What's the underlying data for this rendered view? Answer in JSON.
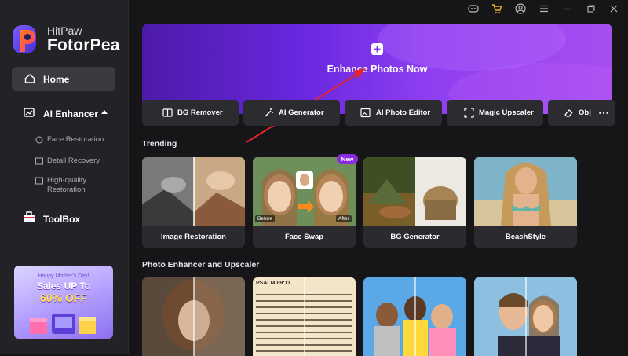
{
  "brand": {
    "line1": "HitPaw",
    "line2": "FotorPea"
  },
  "sidebar": {
    "home": "Home",
    "ai_enhancer": "AI Enhancer",
    "sub_items": [
      {
        "label": "Face Restoration",
        "icon": "face-icon"
      },
      {
        "label": "Detail Recovery",
        "icon": "image-icon"
      },
      {
        "label": "High-quality",
        "label2": "Restoration",
        "icon": "hq-icon"
      }
    ],
    "toolbox": "ToolBox",
    "promo": {
      "line1": "Happy Mother's Day!",
      "line2": "Sales UP To",
      "line3": "60% OFF"
    }
  },
  "hero": {
    "label": "Enhance Photos Now"
  },
  "tools": [
    {
      "label": "BG Remover",
      "icon": "bg-remover-icon"
    },
    {
      "label": "AI Generator",
      "icon": "magic-wand-icon"
    },
    {
      "label": "AI Photo Editor",
      "icon": "photo-edit-icon"
    },
    {
      "label": "Magic Upscaler",
      "icon": "upscale-icon"
    },
    {
      "label": "Obj",
      "icon": "eraser-icon"
    }
  ],
  "trending": {
    "title": "Trending",
    "cards": [
      {
        "label": "Image Restoration"
      },
      {
        "label": "Face Swap",
        "badge": "New",
        "before": "Before",
        "after": "After"
      },
      {
        "label": "BG Generator"
      },
      {
        "label": "BeachStyle"
      }
    ]
  },
  "enhancer": {
    "title": "Photo Enhancer and Upscaler",
    "psalm": "PSALM 89:11"
  },
  "colors": {
    "accent": "#7c3aed",
    "sidebar": "#232327",
    "card": "#2a2a2f"
  }
}
